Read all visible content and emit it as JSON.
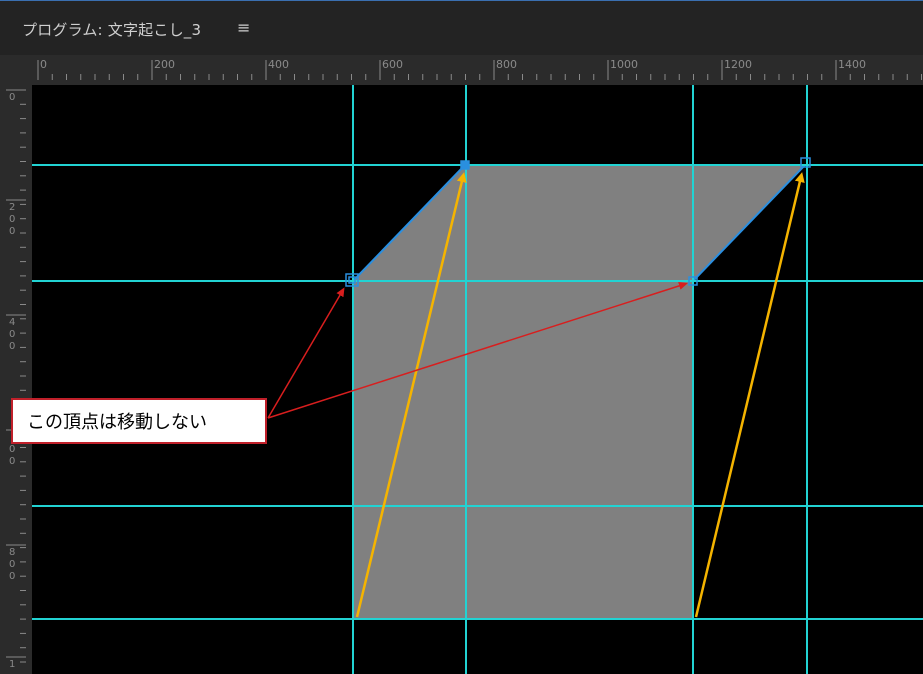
{
  "panel": {
    "title": "プログラム: 文字起こし_3",
    "menu_icon": "≡"
  },
  "ruler": {
    "horizontal_labels": [
      "0",
      "200",
      "400",
      "600",
      "800",
      "1000",
      "1200",
      "1400"
    ],
    "vertical_labels": [
      "0",
      "2\n0\n0",
      "4\n0\n0",
      "6\n0\n0",
      "8\n0\n0",
      "1"
    ]
  },
  "annotation": {
    "callout_text": "この頂点は移動しない"
  },
  "colors": {
    "guide": "#22d3d3",
    "shape_fill": "#808080",
    "yellow_arrow": "#f5b400",
    "red_arrow": "#d81e1e",
    "handle": "#2a8fe0"
  }
}
